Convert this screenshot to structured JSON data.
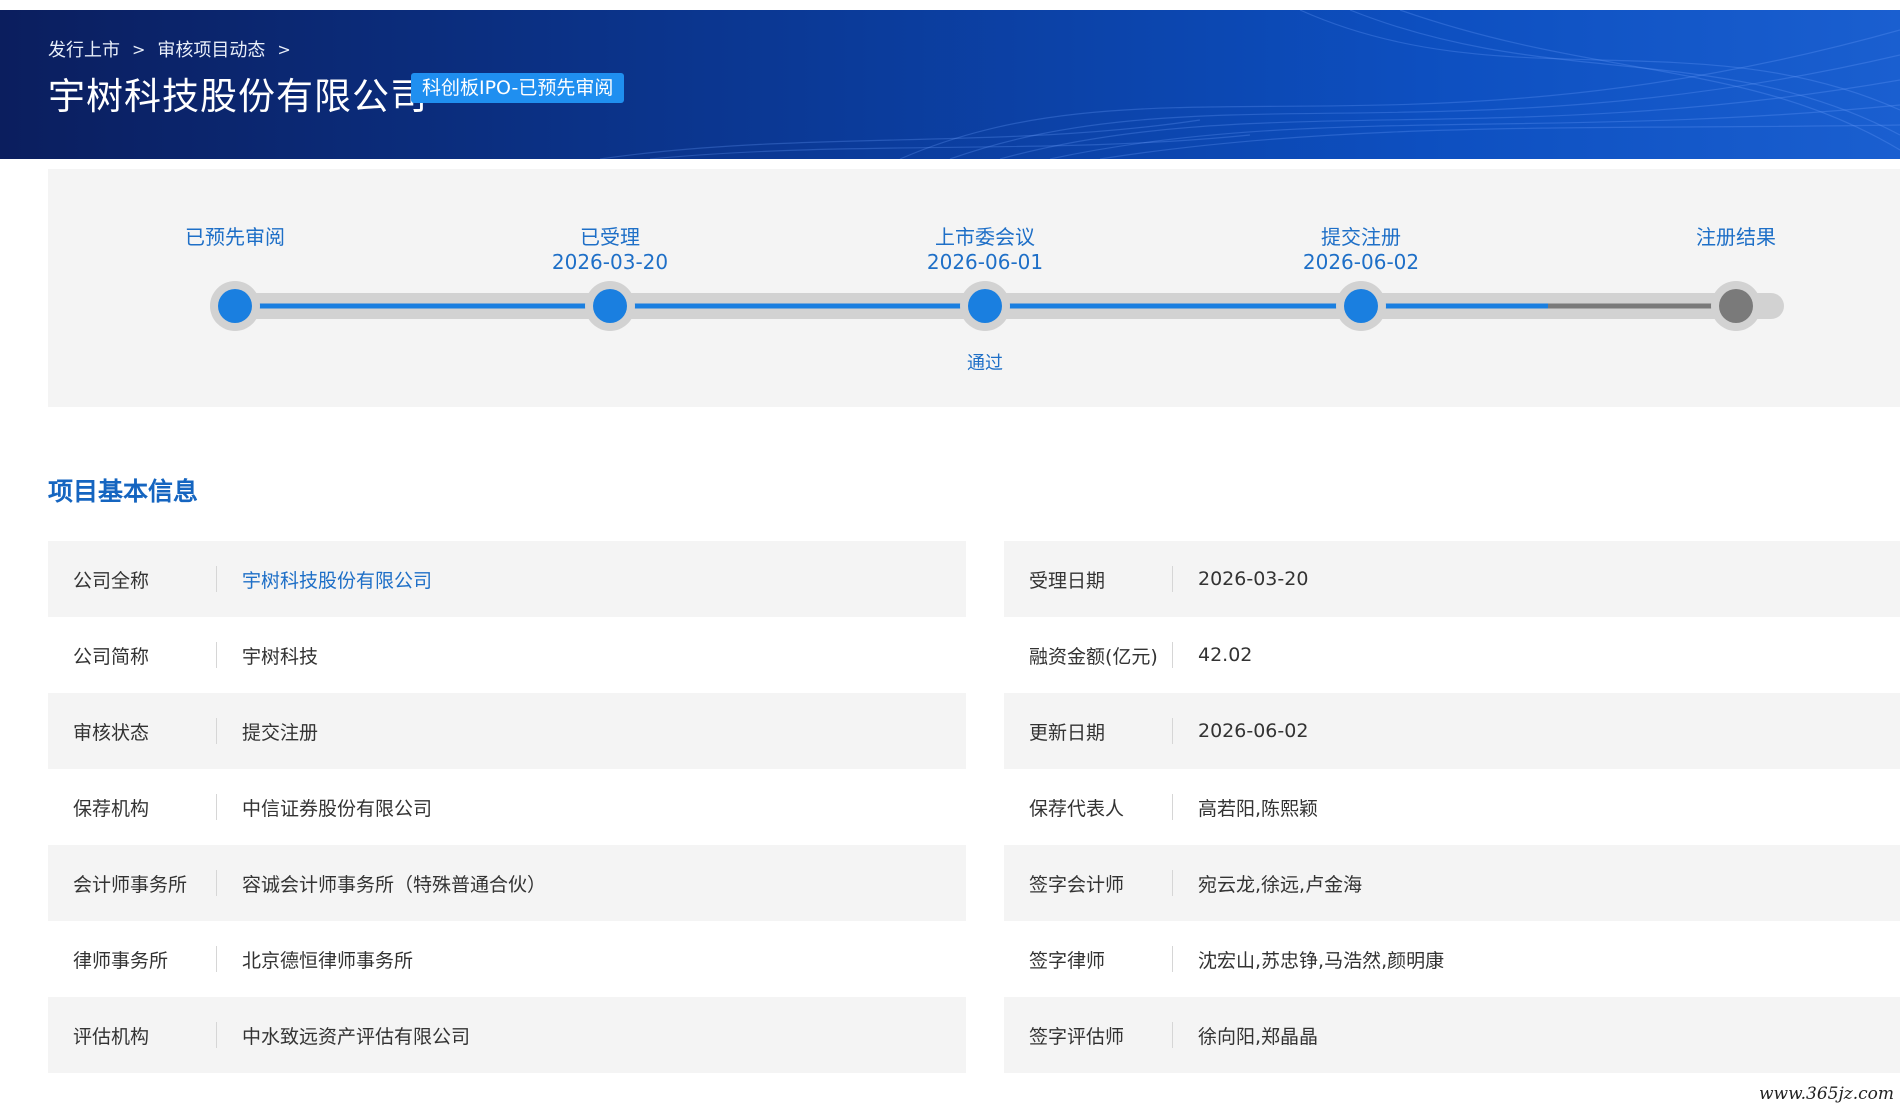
{
  "breadcrumb": {
    "items": [
      "发行上市",
      "审核项目动态"
    ],
    "separator": ">"
  },
  "header": {
    "title": "宇树科技股份有限公司",
    "badge": "科创板IPO-已预先审阅"
  },
  "progress": {
    "steps": [
      {
        "label": "已预先审阅",
        "date": "",
        "note": "",
        "state": "done"
      },
      {
        "label": "已受理",
        "date": "2026-03-20",
        "note": "",
        "state": "done"
      },
      {
        "label": "上市委会议",
        "date": "2026-06-01",
        "note": "通过",
        "state": "done"
      },
      {
        "label": "提交注册",
        "date": "2026-06-02",
        "note": "",
        "state": "current"
      },
      {
        "label": "注册结果",
        "date": "",
        "note": "",
        "state": "pending"
      }
    ],
    "colors": {
      "done": "#1a7fe0",
      "pending": "#7a7a7a",
      "track": "#d2d2d2"
    }
  },
  "section": {
    "title": "项目基本信息"
  },
  "info_left": [
    {
      "key": "公司全称",
      "value": "宇树科技股份有限公司",
      "link": true
    },
    {
      "key": "公司简称",
      "value": "宇树科技"
    },
    {
      "key": "审核状态",
      "value": "提交注册"
    },
    {
      "key": "保荐机构",
      "value": "中信证券股份有限公司"
    },
    {
      "key": "会计师事务所",
      "value": "容诚会计师事务所（特殊普通合伙）"
    },
    {
      "key": "律师事务所",
      "value": "北京德恒律师事务所"
    },
    {
      "key": "评估机构",
      "value": "中水致远资产评估有限公司"
    }
  ],
  "info_right": [
    {
      "key": "受理日期",
      "value": "2026-03-20"
    },
    {
      "key": "融资金额(亿元)",
      "value": "42.02"
    },
    {
      "key": "更新日期",
      "value": "2026-06-02"
    },
    {
      "key": "保荐代表人",
      "value": "高若阳,陈熙颖"
    },
    {
      "key": "签字会计师",
      "value": "宛云龙,徐远,卢金海"
    },
    {
      "key": "签字律师",
      "value": "沈宏山,苏忠铮,马浩然,颜明康"
    },
    {
      "key": "签字评估师",
      "value": "徐向阳,郑晶晶"
    }
  ],
  "watermark": "www.365jz.com"
}
